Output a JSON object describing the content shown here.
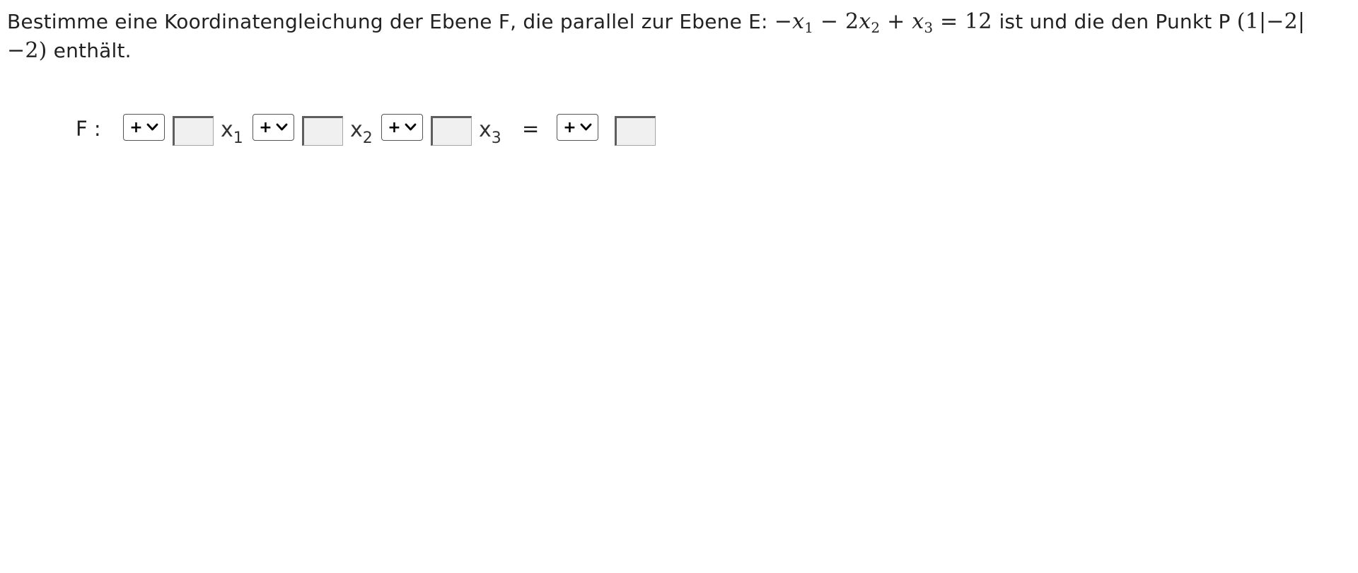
{
  "question": {
    "text_before": "Bestimme eine Koordinatengleichung der Ebene F, die parallel zur Ebene E:",
    "plane_equation": {
      "t1_sign": "−",
      "t1_var": "x",
      "t1_sub": "1",
      "op2": "−",
      "t2_coef": "2",
      "t2_var": "x",
      "t2_sub": "2",
      "op3": "+",
      "t3_var": "x",
      "t3_sub": "3",
      "equals": "=",
      "rhs": "12"
    },
    "text_middle": "ist und die den Punkt P",
    "point": "(1|−2|−2)",
    "text_after": "enthält."
  },
  "answer": {
    "plane_label": "F :",
    "x1_var": "x",
    "x1_sub": "1",
    "x2_var": "x",
    "x2_sub": "2",
    "x3_var": "x",
    "x3_sub": "3",
    "equals": "=",
    "sign1": "+",
    "sign2": "+",
    "sign3": "+",
    "sign_rhs": "+",
    "coef1_value": "",
    "coef2_value": "",
    "coef3_value": "",
    "rhs_value": ""
  },
  "icons": {
    "dropdown": "chevron-down-icon"
  }
}
